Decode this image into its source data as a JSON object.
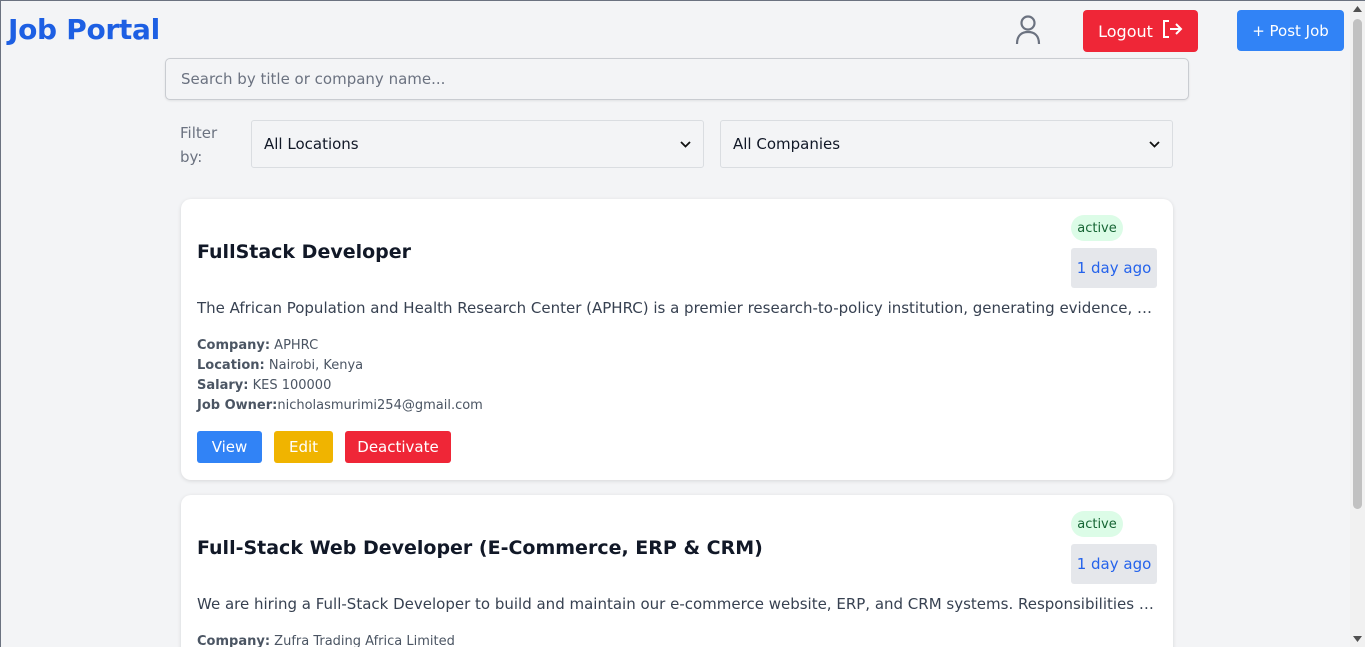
{
  "header": {
    "logo": "Job Portal",
    "logout_label": "Logout",
    "post_job_label": "+ Post Job"
  },
  "search": {
    "placeholder": "Search by title or company name..."
  },
  "filters": {
    "label": "Filter by:",
    "location_selected": "All Locations",
    "company_selected": "All Companies"
  },
  "jobs": [
    {
      "title": "FullStack Developer",
      "status": "active",
      "posted": "1 day ago",
      "description": "The African Population and Health Research Center (APHRC) is a premier research-to-policy institution, generating evidence, strengthe...",
      "company_label": "Company:",
      "company": "APHRC",
      "location_label": "Location:",
      "location": "Nairobi, Kenya",
      "salary_label": "Salary:",
      "salary": "KES 100000",
      "owner_label": "Job Owner:",
      "owner": "nicholasmurimi254@gmail.com",
      "view_label": "View",
      "edit_label": "Edit",
      "deactivate_label": "Deactivate"
    },
    {
      "title": "Full-Stack Web Developer (E-Commerce, ERP & CRM)",
      "status": "active",
      "posted": "1 day ago",
      "description": "We are hiring a Full-Stack Developer to build and maintain our e-commerce website, ERP, and CRM systems. Responsibilities include d...",
      "company_label": "Company:",
      "company": "Zufra Trading Africa Limited"
    }
  ],
  "colors": {
    "brand": "#1d5fe3",
    "logout": "#ef2637",
    "primary": "#3183f6",
    "edit": "#f0b400",
    "danger": "#ef2637"
  }
}
